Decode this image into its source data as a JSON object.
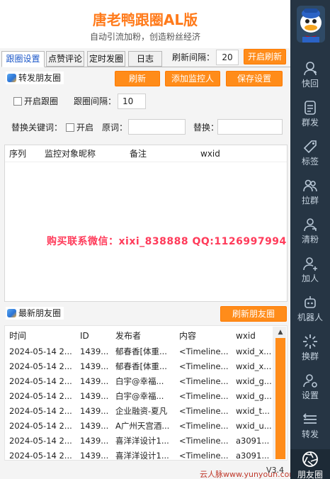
{
  "app": {
    "title": "唐老鸭跟圈AL版",
    "subtitle": "自动引流加粉，创造粉丝经济",
    "version": "V3.4"
  },
  "tabs": [
    {
      "label": "跟圈设置",
      "active": true
    },
    {
      "label": "点赞评论"
    },
    {
      "label": "定时发圈"
    },
    {
      "label": "日志"
    }
  ],
  "refresh": {
    "interval_label": "刷新间隔：",
    "interval_value": "20",
    "button": "开启刷新"
  },
  "forward": {
    "title": "转发朋友圈",
    "btn_refresh": "刷新",
    "btn_add": "添加监控人",
    "btn_save": "保存设置",
    "enable_label": "开启跟圈",
    "interval_label": "跟圈间隔：",
    "interval_value": "10",
    "replace_kw_label": "替换关键词：",
    "replace_enable": "开启",
    "original_label": "原词：",
    "original_value": "",
    "replace_label": "替换：",
    "replace_value": "",
    "columns": [
      "序列",
      "监控对象昵称",
      "备注",
      "wxid"
    ],
    "rows": []
  },
  "watermark": "购买联系微信：xixi_838888   QQ:1126997994",
  "latest": {
    "title": "最新朋友圈",
    "btn_refresh": "刷新朋友圈",
    "columns": [
      "时间",
      "ID",
      "发布者",
      "内容",
      "wxid"
    ],
    "rows": [
      [
        "2024-05-14 2...",
        "1439...",
        "郁春香[体重...",
        "<Timeline...",
        "wxid_x..."
      ],
      [
        "2024-05-14 2...",
        "1439...",
        "郁春香[体重...",
        "<Timeline...",
        "wxid_x..."
      ],
      [
        "2024-05-14 2...",
        "1439...",
        "白宇@幸福...",
        "<Timeline...",
        "wxid_g..."
      ],
      [
        "2024-05-14 2...",
        "1439...",
        "白宇@幸福...",
        "<Timeline...",
        "wxid_g..."
      ],
      [
        "2024-05-14 2...",
        "1439...",
        "企业融资-夏凡",
        "<Timeline...",
        "wxid_t..."
      ],
      [
        "2024-05-14 2...",
        "1439...",
        "A广州天宫酒...",
        "<Timeline...",
        "wxid_u..."
      ],
      [
        "2024-05-14 2...",
        "1439...",
        "喜洋洋设计1...",
        "<Timeline...",
        "a3091..."
      ],
      [
        "2024-05-14 2...",
        "1439...",
        "喜洋洋设计1...",
        "<Timeline...",
        "a3091..."
      ]
    ]
  },
  "sidebar": {
    "items": [
      "快回",
      "群发",
      "标签",
      "拉群",
      "清粉",
      "加人",
      "机器人",
      "换群",
      "设置",
      "转发",
      "朋友圈"
    ]
  },
  "footer_mark": "云人脉www.yunyoun.com",
  "colors": {
    "accent": "#ff8c1a",
    "sidebar": "#263544",
    "title": "#ff7a1a",
    "watermark": "#ff3b5a"
  }
}
